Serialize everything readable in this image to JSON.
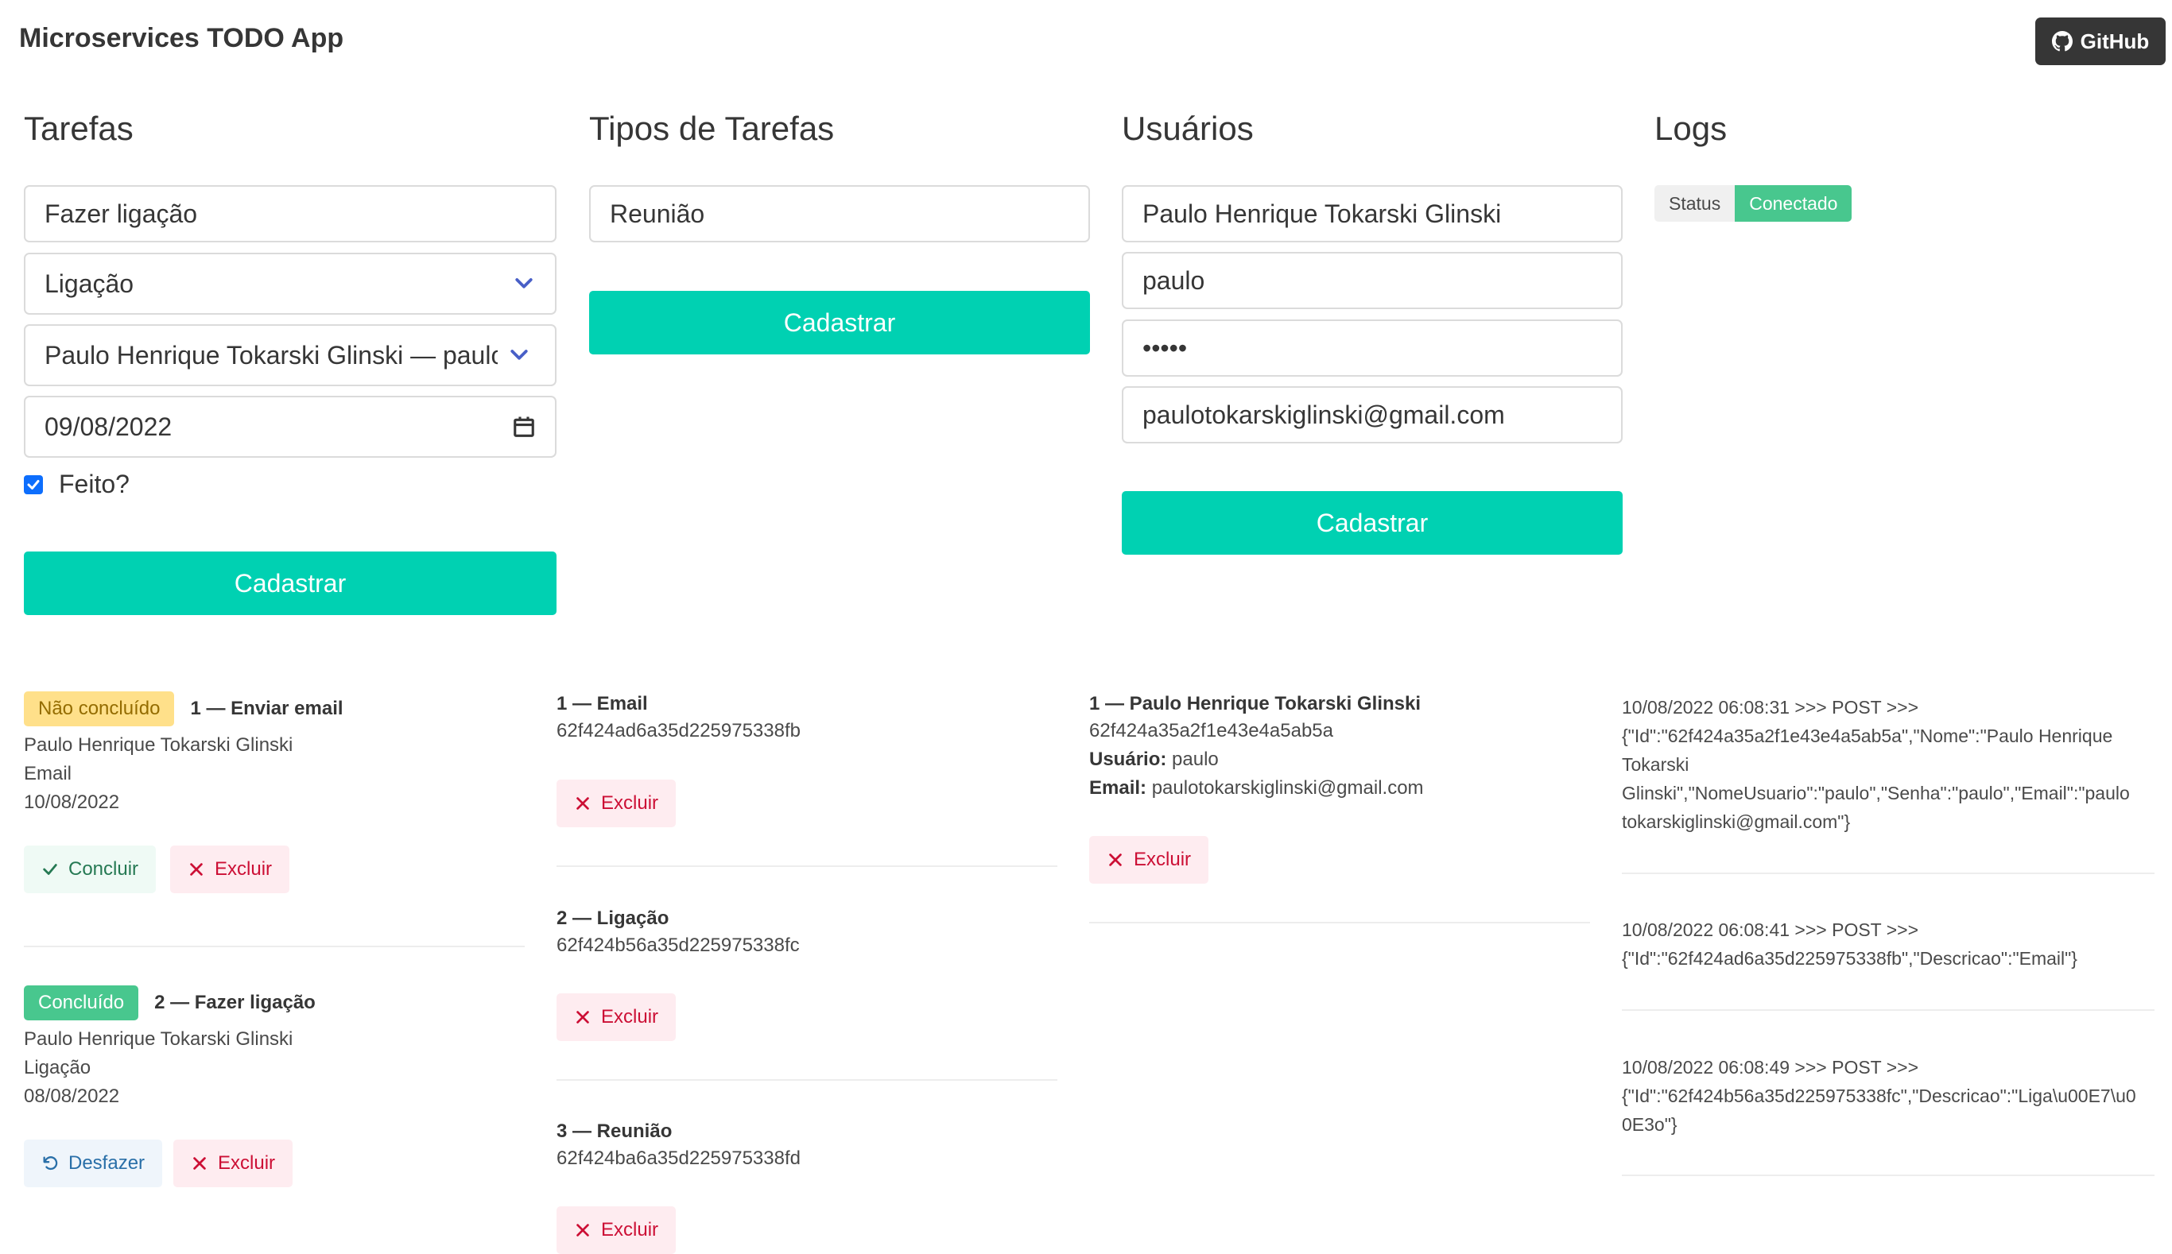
{
  "app": {
    "title": "Microservices TODO App",
    "github_label": "GitHub"
  },
  "tarefas": {
    "title": "Tarefas",
    "form": {
      "descricao": "Fazer ligação",
      "tipo": "Ligação",
      "usuario": "Paulo Henrique Tokarski Glinski — paulo",
      "data": "09/08/2022",
      "feito_label": "Feito?",
      "feito_checked": true,
      "submit": "Cadastrar"
    },
    "items": [
      {
        "status": "Não concluído",
        "title": "1 — Enviar email",
        "usuario": "Paulo Henrique Tokarski Glinski",
        "tipo": "Email",
        "data": "10/08/2022",
        "action_label": "Concluir",
        "delete_label": "Excluir"
      },
      {
        "status": "Concluído",
        "title": "2 — Fazer ligação",
        "usuario": "Paulo Henrique Tokarski Glinski",
        "tipo": "Ligação",
        "data": "08/08/2022",
        "action_label": "Desfazer",
        "delete_label": "Excluir"
      }
    ]
  },
  "tipos": {
    "title": "Tipos de Tarefas",
    "form": {
      "descricao": "Reunião",
      "submit": "Cadastrar"
    },
    "items": [
      {
        "title": "1 — Email",
        "id": "62f424ad6a35d225975338fb",
        "delete_label": "Excluir"
      },
      {
        "title": "2 — Ligação",
        "id": "62f424b56a35d225975338fc",
        "delete_label": "Excluir"
      },
      {
        "title": "3 — Reunião",
        "id": "62f424ba6a35d225975338fd",
        "delete_label": "Excluir"
      }
    ]
  },
  "usuarios": {
    "title": "Usuários",
    "form": {
      "nome": "Paulo Henrique Tokarski Glinski",
      "usuario": "paulo",
      "senha": "•••••",
      "email": "paulotokarskiglinski@gmail.com",
      "submit": "Cadastrar"
    },
    "items": [
      {
        "title": "1 — Paulo Henrique Tokarski Glinski",
        "id": "62f424a35a2f1e43e4a5ab5a",
        "usuario_label": "Usuário:",
        "usuario": "paulo",
        "email_label": "Email:",
        "email": "paulotokarskiglinski@gmail.com",
        "delete_label": "Excluir"
      }
    ]
  },
  "logs": {
    "title": "Logs",
    "status_label": "Status",
    "status_value": "Conectado",
    "entries": [
      {
        "header": "10/08/2022 06:08:31 >>> POST >>>",
        "l1": "{\"Id\":\"62f424a35a2f1e43e4a5ab5a\",\"Nome\":\"Paulo Henrique",
        "l2": "Tokarski",
        "l3": "Glinski\",\"NomeUsuario\":\"paulo\",\"Senha\":\"paulo\",\"Email\":\"paulo",
        "l4": "tokarskiglinski@gmail.com\"}"
      },
      {
        "header": "10/08/2022 06:08:41 >>> POST >>>",
        "l1": "{\"Id\":\"62f424ad6a35d225975338fb\",\"Descricao\":\"Email\"}"
      },
      {
        "header": "10/08/2022 06:08:49 >>> POST >>>",
        "l1": "{\"Id\":\"62f424b56a35d225975338fc\",\"Descricao\":\"Liga\\u00E7\\u0",
        "l2": "0E3o\"}"
      }
    ]
  },
  "colors": {
    "primary": "#00d1b2",
    "success": "#48c78e",
    "warning": "#ffe08a",
    "danger": "#cc0f35"
  }
}
